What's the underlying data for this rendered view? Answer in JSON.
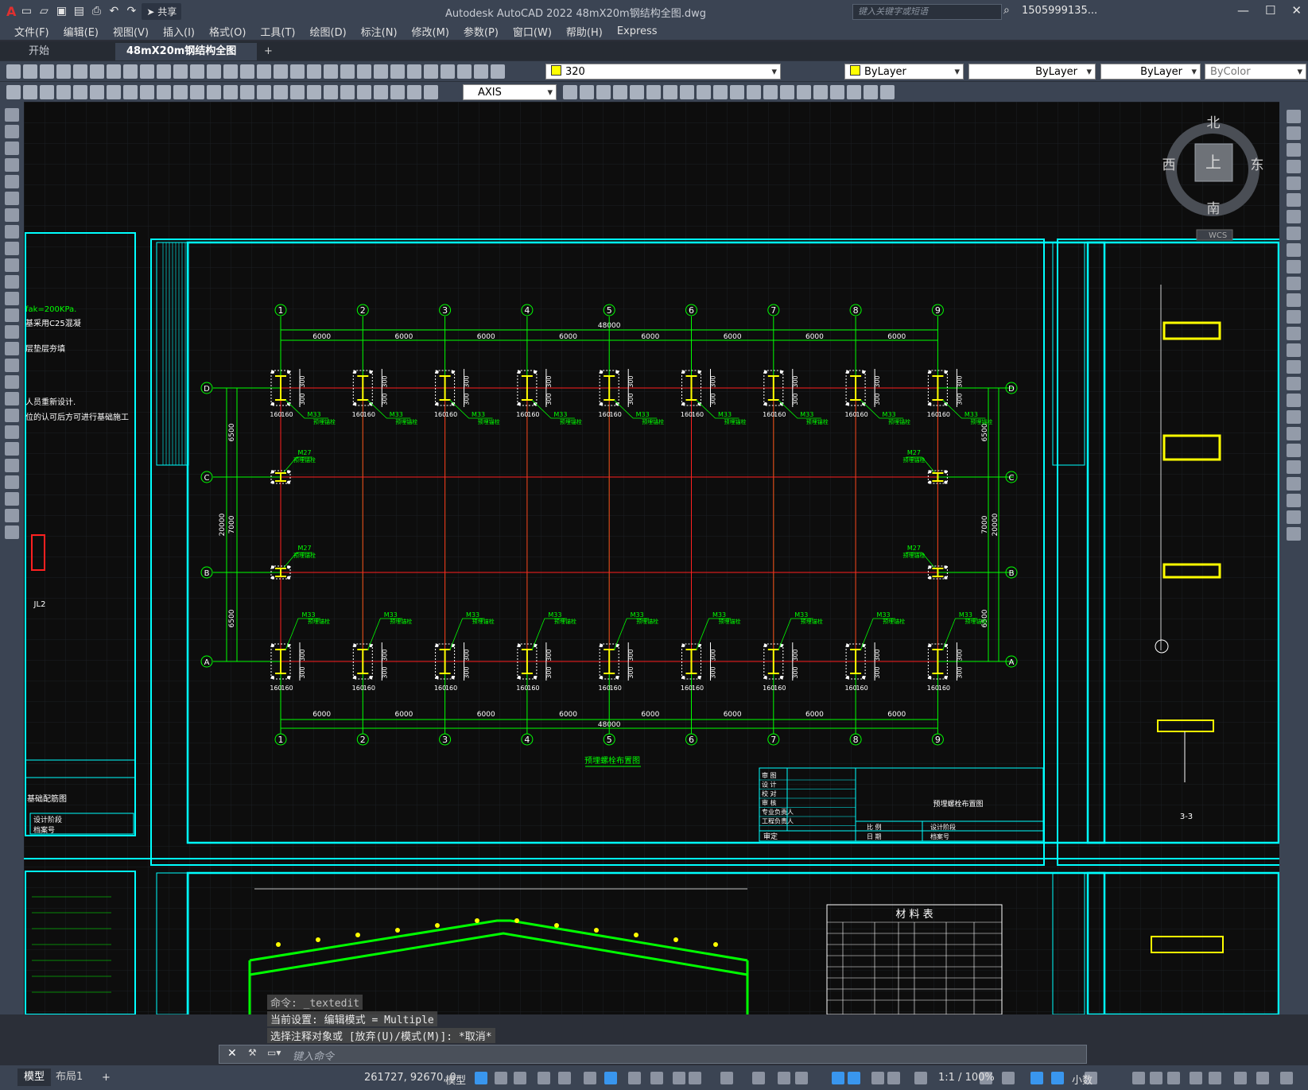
{
  "app": {
    "title": "Autodesk AutoCAD 2022    48mX20m钢结构全图.dwg",
    "logo": "A",
    "share_label": "共享",
    "search_placeholder": "键入关键字或短语",
    "user": "1505999135..."
  },
  "menu": [
    "文件(F)",
    "编辑(E)",
    "视图(V)",
    "插入(I)",
    "格式(O)",
    "工具(T)",
    "绘图(D)",
    "标注(N)",
    "修改(M)",
    "参数(P)",
    "窗口(W)",
    "帮助(H)",
    "Express"
  ],
  "tabs": {
    "start": "开始",
    "doc": "48mX20m钢结构全图*",
    "close": "✕",
    "add": "+"
  },
  "toolbar": {
    "layer_value": "320",
    "color": "ByLayer",
    "linetype": "ByLayer",
    "lineweight": "ByLayer",
    "plotstyle": "ByColor",
    "dimstyle": "AXIS"
  },
  "viewcube": {
    "north": "北",
    "south": "南",
    "east": "东",
    "west": "西",
    "top": "上",
    "wcs": "WCS"
  },
  "drawing": {
    "axes_top": [
      "1",
      "2",
      "3",
      "4",
      "5",
      "6",
      "7",
      "8",
      "9"
    ],
    "axes_side": [
      "D",
      "C",
      "B",
      "A"
    ],
    "bay": "6000",
    "total": "48000",
    "span": "20000",
    "dim_6500": "6500",
    "dim_7000": "7000",
    "dim_300": "300",
    "dim_160": "160",
    "bolt_m33": "M33",
    "bolt_m27": "M27",
    "bolt_note": "预埋锚栓",
    "plan_title": "预埋螺栓布置图",
    "tb_rows": [
      "审 图",
      "设 计",
      "校 对",
      "审 核",
      "专业负责人",
      "工程负责人"
    ],
    "tb_title": "预埋螺栓布置图",
    "tb_scale": "比 例",
    "tb_date": "日 期",
    "tb_approve": "审定",
    "tb_design_phase": "设计阶段",
    "tb_archive": "档案号",
    "left_notes": [
      "fak=200KPa.",
      "基采用C25混凝",
      "层垫层夯填",
      "人员重新设计.",
      "位的认可后方可进行基础施工"
    ],
    "left_title": "基础配筋图",
    "jl2": "JL2",
    "material_title": "材 料 表",
    "section": "3-3"
  },
  "command": {
    "line1": "命令: _textedit",
    "line2": "当前设置: 编辑模式 = Multiple",
    "line3": "选择注释对象或 [放弃(U)/模式(M)]: *取消*",
    "placeholder": "键入命令"
  },
  "status": {
    "model_tab": "模型",
    "layout_tab": "布局1",
    "add": "+",
    "coords": "261727, 92670, 0",
    "model": "模型",
    "scale": "1:1 / 100%",
    "units": "小数"
  }
}
